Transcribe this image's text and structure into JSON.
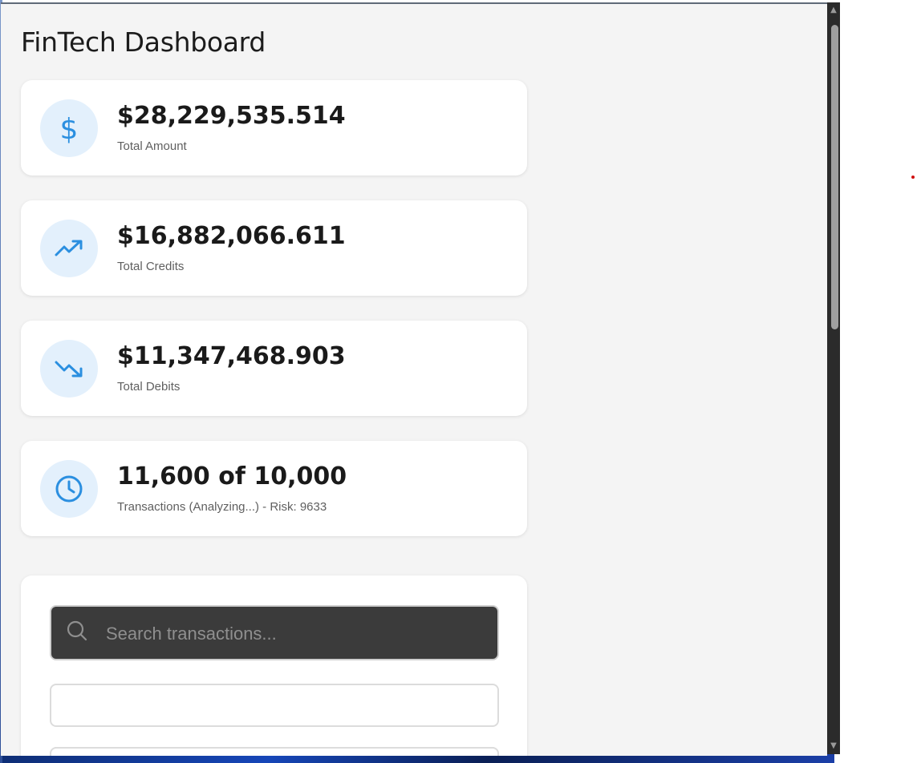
{
  "page": {
    "title": "FinTech Dashboard"
  },
  "stats": [
    {
      "icon": "dollar-icon",
      "value": "$28,229,535.514",
      "label": "Total Amount"
    },
    {
      "icon": "trending-up-icon",
      "value": "$16,882,066.611",
      "label": "Total Credits"
    },
    {
      "icon": "trending-down-icon",
      "value": "$11,347,468.903",
      "label": "Total Debits"
    },
    {
      "icon": "clock-icon",
      "value": "11,600 of 10,000",
      "label": "Transactions (Analyzing...) - Risk: 9633"
    }
  ],
  "filters": {
    "search_placeholder": "Search transactions...",
    "search_value": "",
    "select_1_value": "",
    "select_2_value": ""
  },
  "colors": {
    "accent": "#2b8fe0",
    "icon_bg": "#e3f0fc",
    "page_bg": "#f4f4f4",
    "card_bg": "#ffffff",
    "search_bg": "#3b3b3b"
  }
}
